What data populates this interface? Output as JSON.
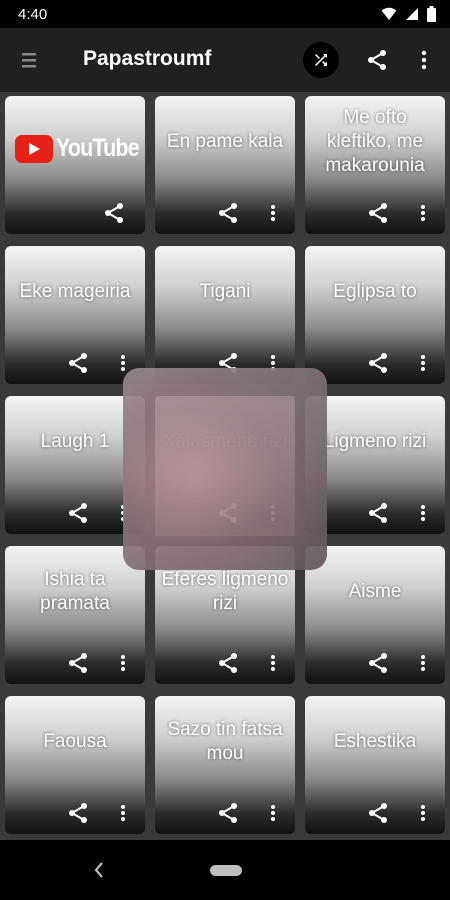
{
  "status_bar": {
    "time": "4:40",
    "icons": [
      "wifi-icon",
      "signal-icon",
      "battery-icon"
    ]
  },
  "app_bar": {
    "title": "Papastroumf",
    "icons": [
      "menu-icon",
      "shuffle-icon",
      "share-icon",
      "more-vert-icon"
    ]
  },
  "tiles": [
    {
      "label": "",
      "logo": "YouTube",
      "has_more": false
    },
    {
      "label": "En pame kala",
      "has_more": true
    },
    {
      "label": "Me ofto kleftiko, me makarounia",
      "has_more": true
    },
    {
      "label": "Eke mageiria",
      "has_more": true
    },
    {
      "label": "Tigani",
      "has_more": true
    },
    {
      "label": "Eglipsa to",
      "has_more": true
    },
    {
      "label": "Laugh 1",
      "has_more": true
    },
    {
      "label": "Xalasmeno rizi",
      "has_more": true
    },
    {
      "label": "Ligmeno rizi",
      "has_more": true
    },
    {
      "label": "Ishia ta pramata",
      "has_more": true
    },
    {
      "label": "Eferes ligmeno rizi",
      "has_more": true
    },
    {
      "label": "Aisme",
      "has_more": true
    },
    {
      "label": "Faousa",
      "has_more": true
    },
    {
      "label": "Sazo tin fatsa mou",
      "has_more": true
    },
    {
      "label": "Eshestika",
      "has_more": true
    }
  ],
  "colors": {
    "app_bar": "#202020",
    "shuffle_circle": "#000000",
    "youtube_red": "#e62117"
  }
}
